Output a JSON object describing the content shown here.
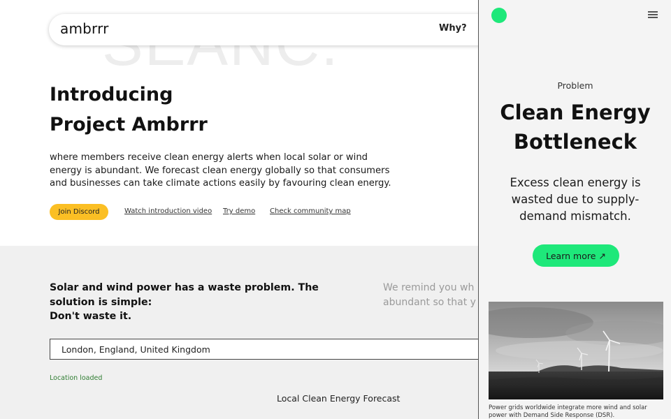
{
  "header": {
    "logo": "ambrrr",
    "watermark": "SEANC.",
    "nav_why": "Why?"
  },
  "hero": {
    "title_lines": [
      "Introducing",
      "Project Ambrrr"
    ],
    "description": "where members receive clean energy alerts when local solar or wind energy is abundant. We forecast clean energy globally so that consumers and businesses can take climate actions easily by favouring clean energy.",
    "join_label": "Join Discord",
    "links": [
      {
        "label": "Watch introduction video"
      },
      {
        "label": "Try demo"
      },
      {
        "label": "Check community map"
      }
    ]
  },
  "waste": {
    "heading_lines": [
      "Solar and wind power has a waste problem. The",
      "solution is simple:",
      "Don't waste it."
    ],
    "remind_lines": [
      "We remind you wh",
      "abundant so that y"
    ]
  },
  "location": {
    "value": "London, England, United Kingdom",
    "status": "Location loaded"
  },
  "forecast": {
    "title": "Local Clean Energy Forecast"
  },
  "panel": {
    "eyebrow": "Problem",
    "title_lines": [
      "Clean Energy",
      "Bottleneck"
    ],
    "subtitle_lines": [
      "Excess clean energy is",
      "wasted due to supply-",
      "demand mismatch."
    ],
    "cta_label": "Learn more ↗",
    "caption_lines": [
      "Power grids worldwide integrate more wind and solar",
      "power with Demand Side Response (DSR)."
    ]
  },
  "colors": {
    "accent_green": "#1ee87a",
    "discord_yellow": "#fbbf24",
    "status_green": "#2f7d32",
    "section_gray": "#f0f0f0"
  },
  "icons": {
    "panel_logo": "green-dot-icon",
    "panel_menu": "hamburger-menu-icon"
  }
}
